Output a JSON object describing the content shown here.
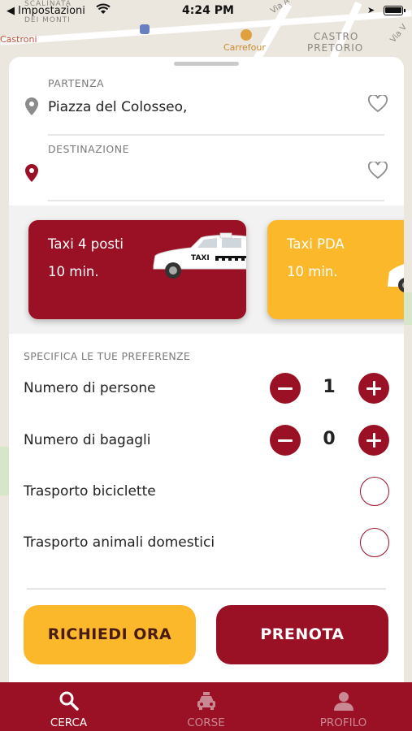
{
  "status_bar": {
    "back_label": "◀ Impostazioni",
    "time": "4:24 PM"
  },
  "map": {
    "labels": {
      "scalinata": "SCALINATA",
      "dei_monti": "DEI MONTI",
      "castroni": "Castroni",
      "carrefour": "Carrefour",
      "castro": "CASTRO",
      "pretorio": "PRETORIO",
      "via_a": "Via A",
      "via_v": "Via V"
    }
  },
  "route": {
    "departure_label": "PARTENZA",
    "departure_value": "Piazza del Colosseo,",
    "destination_label": "DESTINAZIONE",
    "destination_value": ""
  },
  "taxi_options": [
    {
      "name": "Taxi 4 posti",
      "eta": "10 min.",
      "color": "#9a1025",
      "selected": true,
      "sign": "TAXI"
    },
    {
      "name": "Taxi PDA",
      "eta": "10 min.",
      "color": "#fbb82b",
      "selected": false
    }
  ],
  "preferences": {
    "title": "SPECIFICA LE TUE PREFERENZE",
    "people": {
      "label": "Numero di persone",
      "value": "1"
    },
    "luggage": {
      "label": "Numero di bagagli",
      "value": "0"
    },
    "bikes": {
      "label": "Trasporto biciclette",
      "checked": false
    },
    "pets": {
      "label": "Trasporto animali domestici",
      "checked": false
    }
  },
  "actions": {
    "request_now": "RICHIEDI ORA",
    "book": "PRENOTA"
  },
  "tabs": [
    {
      "label": "CERCA",
      "icon": "search-icon",
      "active": true
    },
    {
      "label": "CORSE",
      "icon": "car-icon",
      "active": false
    },
    {
      "label": "PROFILO",
      "icon": "person-icon",
      "active": false
    }
  ],
  "colors": {
    "primary": "#9a1025",
    "accent": "#fbb82b"
  }
}
